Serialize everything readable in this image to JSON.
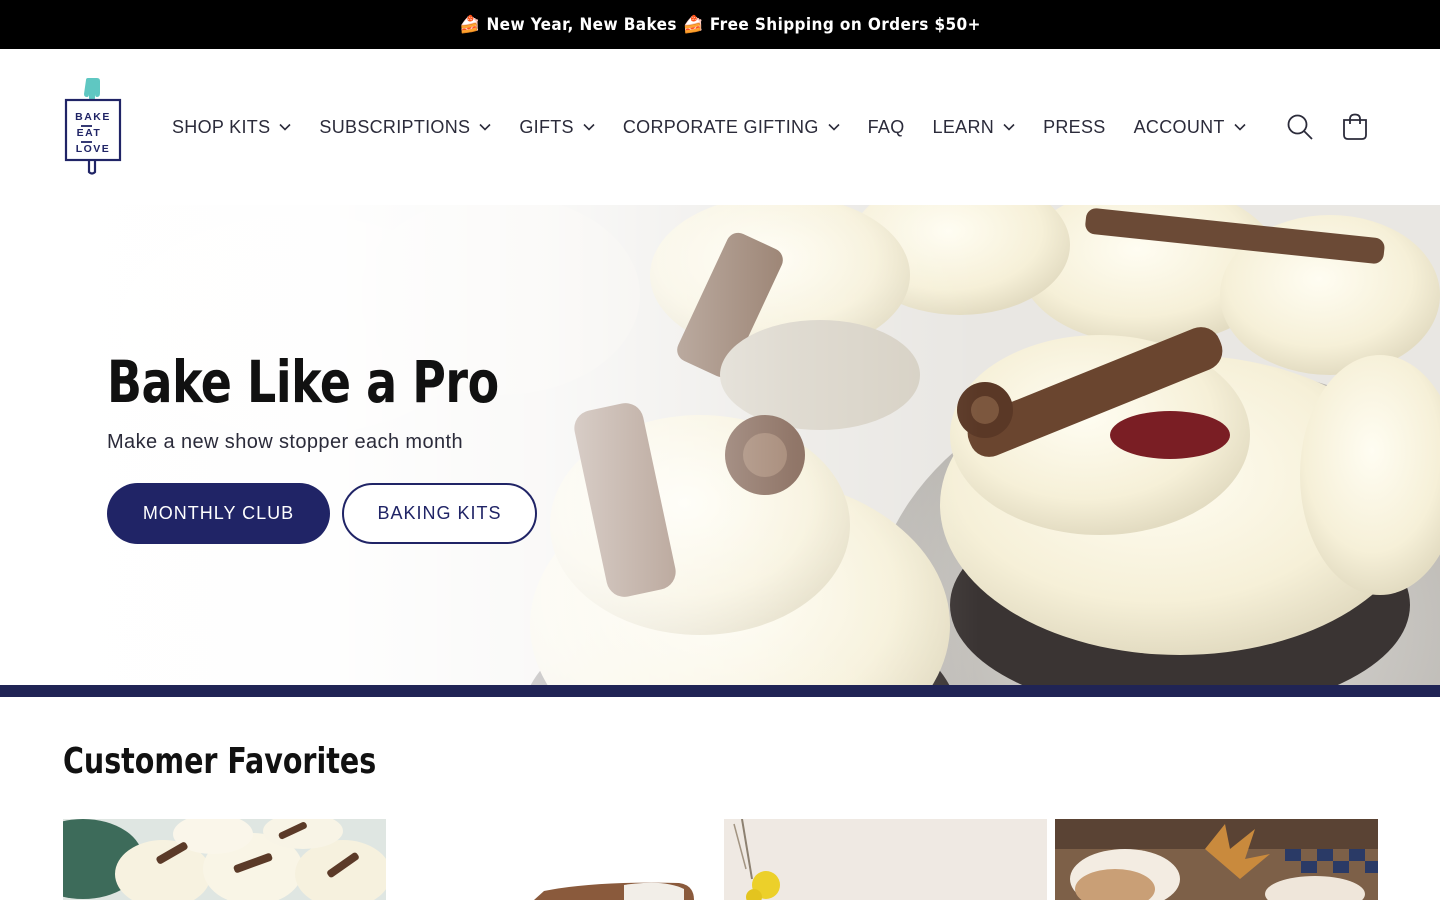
{
  "announcement": {
    "text": "🍰 New Year, New Bakes 🍰 Free Shipping on Orders $50+"
  },
  "header": {
    "logo_lines": [
      "BAKE",
      "EAT",
      "LOVE"
    ],
    "nav": [
      {
        "label": "SHOP KITS",
        "dropdown": true
      },
      {
        "label": "SUBSCRIPTIONS",
        "dropdown": true
      },
      {
        "label": "GIFTS",
        "dropdown": true
      },
      {
        "label": "CORPORATE GIFTING",
        "dropdown": true
      },
      {
        "label": "FAQ",
        "dropdown": false
      },
      {
        "label": "LEARN",
        "dropdown": true
      },
      {
        "label": "PRESS",
        "dropdown": false
      },
      {
        "label": "ACCOUNT",
        "dropdown": true
      }
    ],
    "icons": [
      "search-icon",
      "cart-icon"
    ]
  },
  "hero": {
    "title": "Bake Like a Pro",
    "subtitle": "Make a new show stopper each month",
    "primary_button": "MONTHLY CLUB",
    "secondary_button": "BAKING KITS"
  },
  "favorites": {
    "title": "Customer Favorites"
  },
  "colors": {
    "brand_navy": "#202466",
    "logo_teal": "#5fc7c2",
    "announcement_bg": "#000000"
  }
}
